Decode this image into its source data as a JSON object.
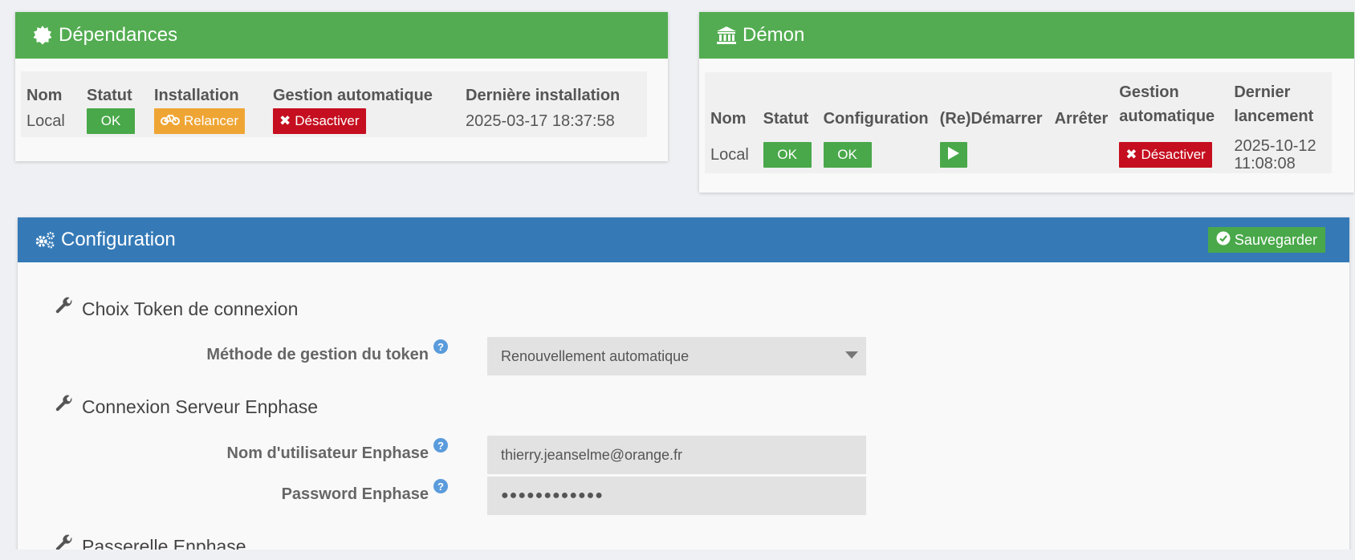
{
  "deps": {
    "title": "Dépendances",
    "headers": [
      "Nom",
      "Statut",
      "Installation",
      "Gestion automatique",
      "Dernière installation"
    ],
    "row": {
      "name": "Local",
      "status": "OK",
      "install_label": "Relancer",
      "auto_label": "Désactiver",
      "last": "2025-03-17 18:37:58"
    }
  },
  "daemon": {
    "title": "Démon",
    "headers": [
      "Nom",
      "Statut",
      "Configuration",
      "(Re)Démarrer",
      "Arrêter",
      "Gestion automatique",
      "Dernier lancement"
    ],
    "row": {
      "name": "Local",
      "status": "OK",
      "config": "OK",
      "auto_label": "Désactiver",
      "last": "2025-10-12 11:08:08"
    }
  },
  "config": {
    "title": "Configuration",
    "save_label": "Sauvegarder",
    "sections": [
      {
        "title": "Choix Token de connexion"
      },
      {
        "title": "Connexion Serveur Enphase"
      },
      {
        "title": "Passerelle Enphase"
      }
    ],
    "fields": {
      "token_method": {
        "label": "Méthode de gestion du token",
        "value": "Renouvellement automatique"
      },
      "username": {
        "label": "Nom d'utilisateur Enphase",
        "value": "thierry.jeanselme@orange.fr"
      },
      "password": {
        "label": "Password Enphase",
        "value": "●●●●●●●●●●●●"
      }
    }
  },
  "colors": {
    "green": "#53ac51",
    "blue": "#357ab7",
    "warn": "#efa534",
    "danger": "#c50e1f"
  }
}
